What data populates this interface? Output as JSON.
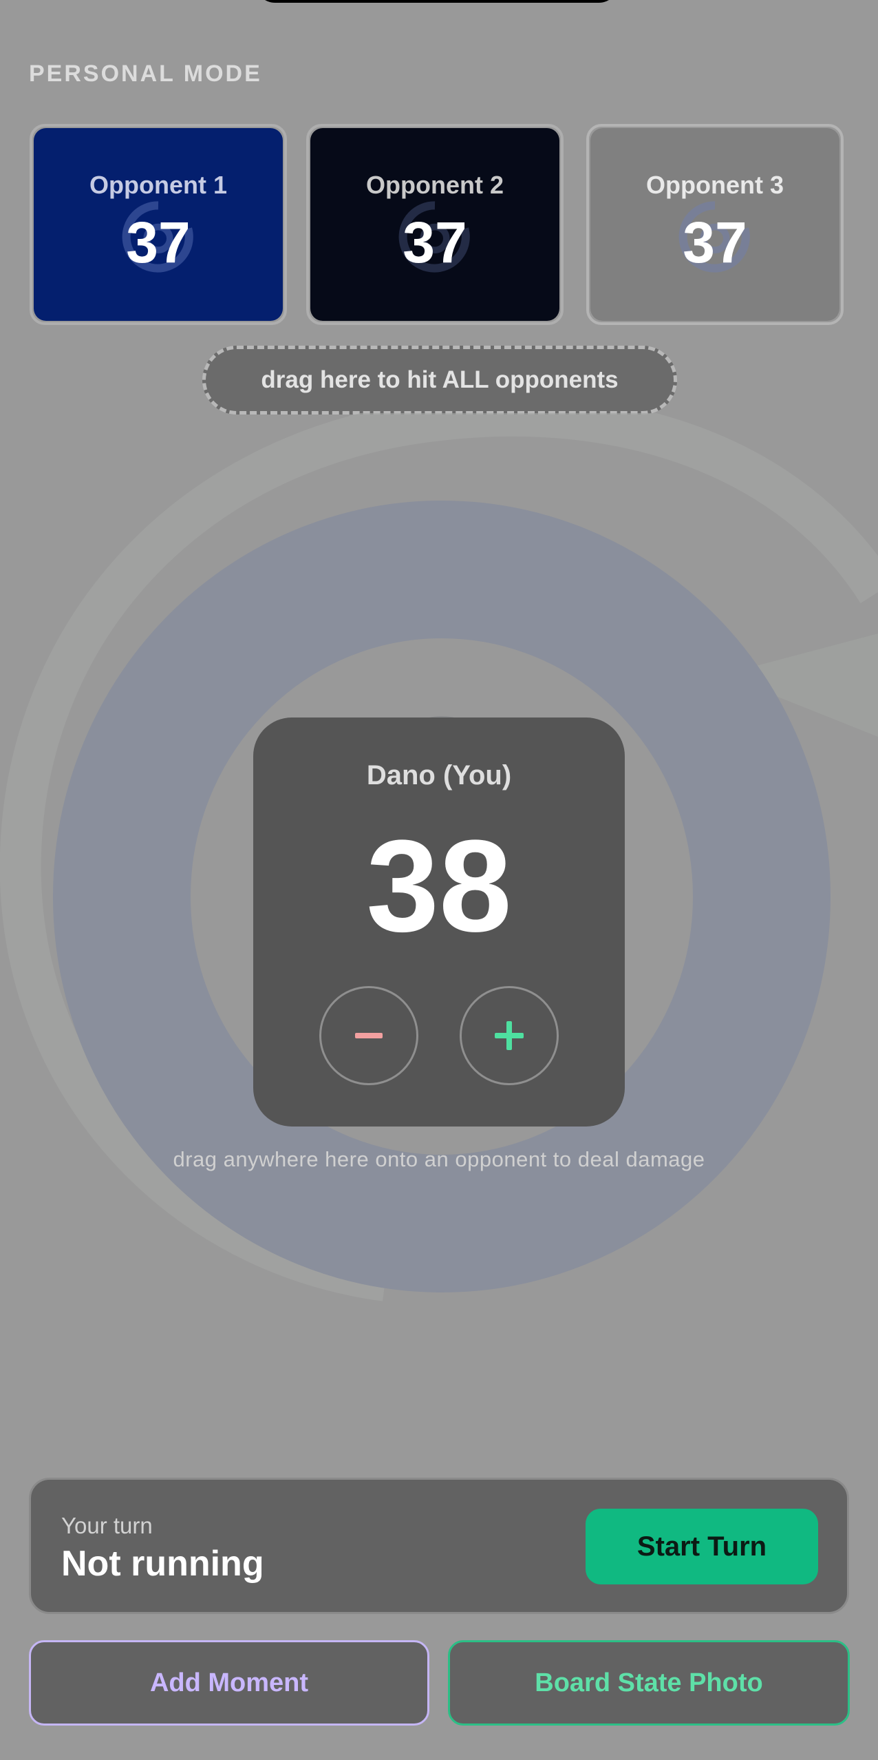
{
  "header": {
    "mode_label": "PERSONAL MODE"
  },
  "opponents": [
    {
      "name": "Opponent 1",
      "life": "37",
      "color": "#041f6e"
    },
    {
      "name": "Opponent 2",
      "life": "37",
      "color": "#060a18"
    },
    {
      "name": "Opponent 3",
      "life": "37",
      "color": "#808080"
    }
  ],
  "hit_all_label": "drag here to hit ALL opponents",
  "player": {
    "name": "Dano (You)",
    "life": "38",
    "decrement_icon": "minus-icon",
    "increment_icon": "plus-icon"
  },
  "hint_text": "drag anywhere here onto an opponent to deal damage",
  "turn": {
    "label": "Your turn",
    "status": "Not running",
    "start_label": "Start Turn",
    "start_color": "#10b981"
  },
  "actions": {
    "add_moment_label": "Add Moment",
    "board_photo_label": "Board State Photo"
  }
}
